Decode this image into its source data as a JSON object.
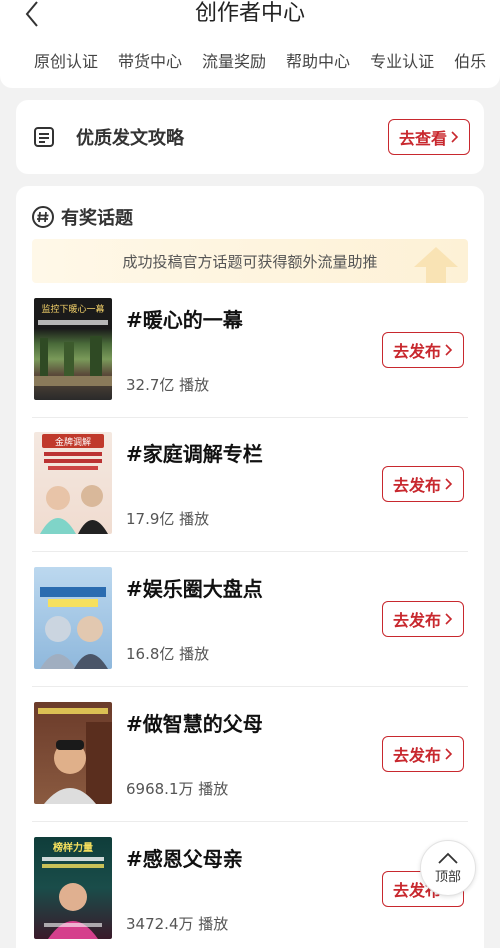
{
  "header": {
    "title": "创作者中心",
    "nav": [
      "原创认证",
      "带货中心",
      "流量奖励",
      "帮助中心",
      "专业认证",
      "伯乐"
    ]
  },
  "strategy": {
    "label": "优质发文攻略",
    "button": "去查看"
  },
  "topics": {
    "label": "有奖话题",
    "banner": "成功投稿官方话题可获得额外流量助推",
    "items": [
      {
        "name": "#暖心的一幕",
        "plays": "32.7亿 播放",
        "button": "去发布",
        "thumb_caption": "监控下暖心一幕"
      },
      {
        "name": "#家庭调解专栏",
        "plays": "17.9亿 播放",
        "button": "去发布",
        "thumb_caption": "金牌调解"
      },
      {
        "name": "#娱乐圈大盘点",
        "plays": "16.8亿 播放",
        "button": "去发布",
        "thumb_caption": ""
      },
      {
        "name": "#做智慧的父母",
        "plays": "6968.1万 播放",
        "button": "去发布",
        "thumb_caption": ""
      },
      {
        "name": "#感恩父母亲",
        "plays": "3472.4万 播放",
        "button": "去发布",
        "thumb_caption": "榜样力量"
      }
    ]
  },
  "top_button": {
    "label": "顶部"
  },
  "colors": {
    "accent": "#c8282e",
    "background": "#f2f2f2",
    "banner": "#fdf1d6"
  }
}
